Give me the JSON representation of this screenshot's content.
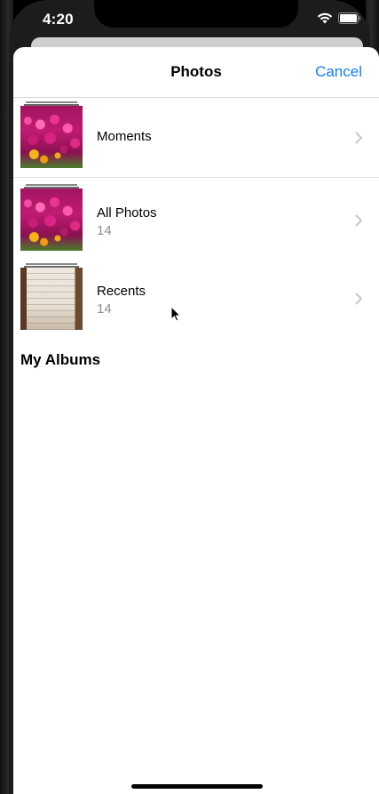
{
  "status_bar": {
    "time": "4:20",
    "icons": [
      "wifi-icon",
      "battery-icon"
    ]
  },
  "nav": {
    "title": "Photos",
    "cancel_label": "Cancel"
  },
  "albums": [
    {
      "name": "Moments",
      "count": "",
      "thumbnail": "flowers-thumbnail"
    },
    {
      "name": "All Photos",
      "count": "14",
      "thumbnail": "flowers-thumbnail"
    },
    {
      "name": "Recents",
      "count": "14",
      "thumbnail": "document-thumbnail"
    }
  ],
  "sections": {
    "my_albums": "My Albums"
  },
  "colors": {
    "accent": "#147efb",
    "secondary_text": "#8e8e93",
    "chevron": "#c7c7cc"
  }
}
